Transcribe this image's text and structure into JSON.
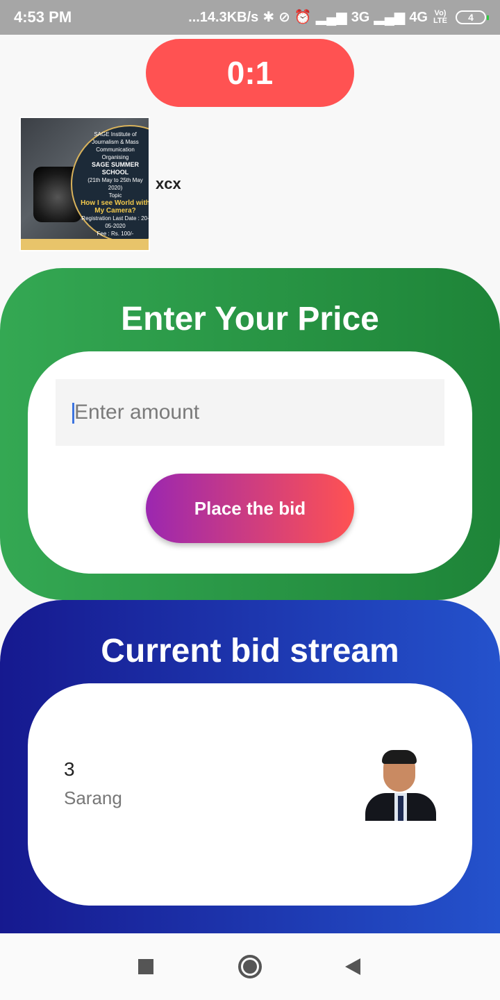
{
  "status_bar": {
    "time": "4:53 PM",
    "network_speed": "...14.3KB/s",
    "network_3g": "3G",
    "network_4g": "4G",
    "volte": "Vo) LTE",
    "battery_level": "4",
    "icons": [
      "bluetooth-icon",
      "dnd-icon",
      "alarm-icon",
      "signal-icon",
      "battery-icon"
    ]
  },
  "timer": {
    "label": "0:1",
    "color": "#ff5252"
  },
  "item": {
    "name": "xcx",
    "poster_text": {
      "institute": "SAGE Institute of Journalism & Mass Communication",
      "organising": "Organising",
      "school": "SAGE SUMMER SCHOOL",
      "dates": "(21th May to 25th May 2020)",
      "topic_label": "Topic",
      "topic": "How I see World with My Camera?",
      "registration": "Registration Last Date : 20-05-2020",
      "fee": "Fee : Rs. 100/-"
    }
  },
  "price_section": {
    "title": "Enter Your Price",
    "input_placeholder": "Enter amount",
    "input_value": "",
    "button_label": "Place the bid",
    "gradient_start": "#34a853",
    "gradient_end": "#1e8438"
  },
  "stream_section": {
    "title": "Current bid stream",
    "bids": [
      {
        "amount": "3",
        "bidder": "Sarang"
      }
    ],
    "gradient_start": "#16198f",
    "gradient_end": "#2452cc"
  },
  "nav_bar": {
    "buttons": [
      "recents-icon",
      "home-icon",
      "back-icon"
    ]
  }
}
